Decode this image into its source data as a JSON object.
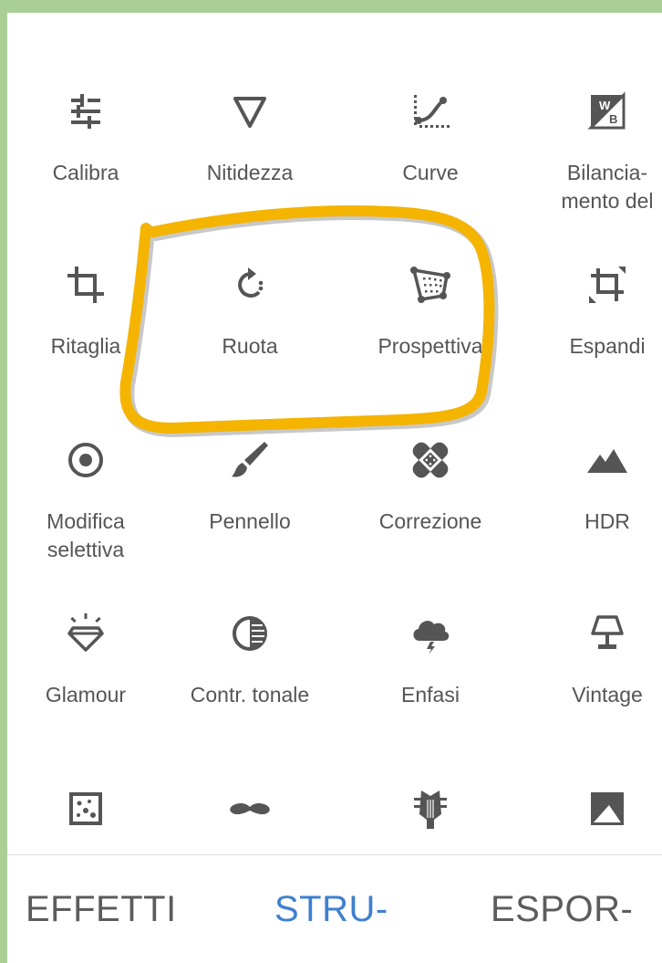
{
  "tools": [
    {
      "label": "Calibra",
      "icon": "tune-sliders-icon"
    },
    {
      "label": "Nitidezza",
      "icon": "triangle-down-icon"
    },
    {
      "label": "Curve",
      "icon": "curve-icon"
    },
    {
      "label": "Bilancia-\nmento del",
      "icon": "white-balance-icon"
    },
    {
      "label": "Ritaglia",
      "icon": "crop-icon"
    },
    {
      "label": "Ruota",
      "icon": "rotate-icon"
    },
    {
      "label": "Prospettiva",
      "icon": "perspective-icon"
    },
    {
      "label": "Espandi",
      "icon": "expand-icon"
    },
    {
      "label": "Modifica\nselettiva",
      "icon": "selective-target-icon"
    },
    {
      "label": "Pennello",
      "icon": "brush-icon"
    },
    {
      "label": "Correzione",
      "icon": "healing-bandage-icon"
    },
    {
      "label": "HDR",
      "icon": "mountains-icon"
    },
    {
      "label": "Glamour",
      "icon": "diamond-icon"
    },
    {
      "label": "Contr. tonale",
      "icon": "tonal-contrast-icon"
    },
    {
      "label": "Enfasi",
      "icon": "storm-cloud-icon"
    },
    {
      "label": "Vintage",
      "icon": "lamp-icon"
    },
    {
      "label": "",
      "icon": "grainy-film-icon"
    },
    {
      "label": "",
      "icon": "mustache-icon"
    },
    {
      "label": "",
      "icon": "guitar-head-icon"
    },
    {
      "label": "",
      "icon": "black-white-icon"
    }
  ],
  "tabs": [
    {
      "label": "EFFETTI",
      "active": false
    },
    {
      "label": "STRU-",
      "active": true
    },
    {
      "label": "ESPOR-",
      "active": false
    }
  ],
  "colors": {
    "accent": "#3f7fd0",
    "icon": "#555555",
    "annotation": "#f4b400",
    "frame": "#a9cf95"
  }
}
